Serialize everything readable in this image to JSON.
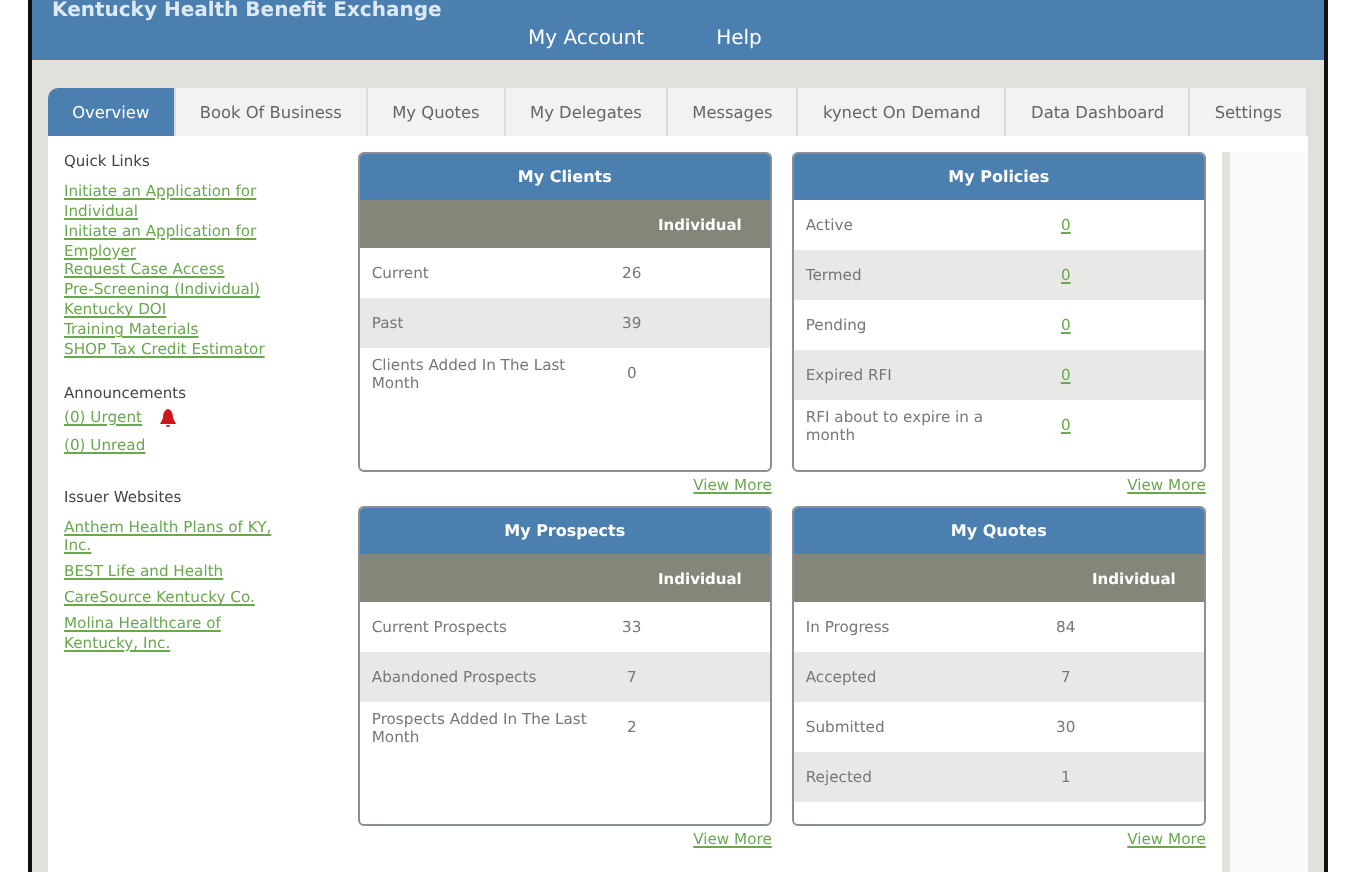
{
  "banner": {
    "title": "Kentucky Health Benefit Exchange",
    "nav": [
      "My Account",
      "Help"
    ]
  },
  "tabs": [
    {
      "label": "Overview",
      "selected": true
    },
    {
      "label": "Book Of Business",
      "selected": false
    },
    {
      "label": "My Quotes",
      "selected": false
    },
    {
      "label": "My Delegates",
      "selected": false
    },
    {
      "label": "Messages",
      "selected": false
    },
    {
      "label": "kynect On Demand",
      "selected": false
    },
    {
      "label": "Data Dashboard",
      "selected": false
    },
    {
      "label": "Settings",
      "selected": false
    }
  ],
  "sidebar": {
    "quick_links_title": "Quick Links",
    "quick_links": [
      "Initiate an Application for Individual",
      "Initiate an Application for Employer",
      "Request Case Access",
      "Pre-Screening (Individual)",
      "Kentucky DOI",
      "Training Materials",
      "SHOP Tax Credit Estimator"
    ],
    "announcements_title": "Announcements",
    "announcements": [
      {
        "label": "(0) Urgent",
        "alert": true
      },
      {
        "label": "(0) Unread",
        "alert": false
      }
    ],
    "issuer_title": "Issuer Websites",
    "issuers": [
      "Anthem Health Plans of KY, Inc.",
      "BEST Life and Health",
      "CareSource Kentucky Co.",
      "Molina Healthcare of Kentucky, Inc."
    ]
  },
  "cards": [
    {
      "title": "My Clients",
      "column_header": "Individual",
      "rows": [
        {
          "label": "Current",
          "value": "26",
          "kind": "count"
        },
        {
          "label": "Past",
          "value": "39",
          "kind": "count"
        },
        {
          "label": "Clients Added In The Last Month",
          "value": "0",
          "kind": "count"
        }
      ],
      "link": "View More"
    },
    {
      "title": "My Policies",
      "rows": [
        {
          "label": "Active",
          "value": "0",
          "kind": "link"
        },
        {
          "label": "Termed",
          "value": "0",
          "kind": "link"
        },
        {
          "label": "Pending",
          "value": "0",
          "kind": "link"
        },
        {
          "label": "Expired RFI",
          "value": "0",
          "kind": "link"
        },
        {
          "label": "RFI about to expire in a month",
          "value": "0",
          "kind": "link"
        }
      ],
      "link": "View More"
    },
    {
      "title": "My Prospects",
      "column_header": "Individual",
      "rows": [
        {
          "label": "Current Prospects",
          "value": "33",
          "kind": "count"
        },
        {
          "label": "Abandoned Prospects",
          "value": "7",
          "kind": "count"
        },
        {
          "label": "Prospects Added In The Last Month",
          "value": "2",
          "kind": "count"
        }
      ],
      "link": "View More"
    },
    {
      "title": "My Quotes",
      "column_header": "Individual",
      "rows": [
        {
          "label": "In Progress",
          "value": "84",
          "kind": "count"
        },
        {
          "label": "Accepted",
          "value": "7",
          "kind": "count"
        },
        {
          "label": "Submitted",
          "value": "30",
          "kind": "count"
        },
        {
          "label": "Rejected",
          "value": "1",
          "kind": "count"
        }
      ],
      "link": "View More"
    }
  ]
}
